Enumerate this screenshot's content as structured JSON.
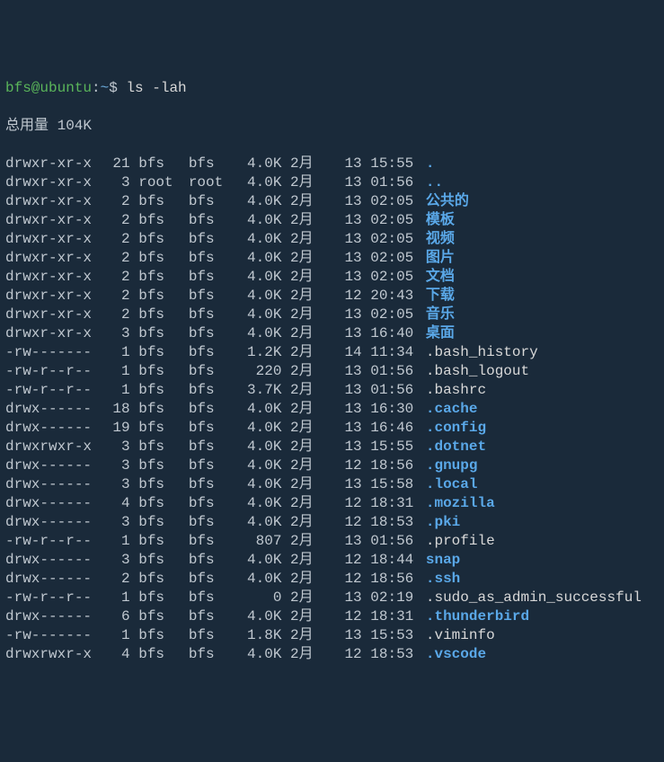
{
  "prompt": {
    "user_host": "bfs@ubuntu",
    "colon": ":",
    "path": "~",
    "symbol": "$ ",
    "command": "ls -lah"
  },
  "total_line": "总用量 104K",
  "rows": [
    {
      "perms": "drwxr-xr-x",
      "links": "21",
      "owner": "bfs",
      "group": "bfs",
      "size": "4.0K",
      "month": "2月",
      "day": "13",
      "time": "15:55",
      "name": ".",
      "kind": "dir"
    },
    {
      "perms": "drwxr-xr-x",
      "links": "3",
      "owner": "root",
      "group": "root",
      "size": "4.0K",
      "month": "2月",
      "day": "13",
      "time": "01:56",
      "name": "..",
      "kind": "dir"
    },
    {
      "perms": "drwxr-xr-x",
      "links": "2",
      "owner": "bfs",
      "group": "bfs",
      "size": "4.0K",
      "month": "2月",
      "day": "13",
      "time": "02:05",
      "name": "公共的",
      "kind": "dir"
    },
    {
      "perms": "drwxr-xr-x",
      "links": "2",
      "owner": "bfs",
      "group": "bfs",
      "size": "4.0K",
      "month": "2月",
      "day": "13",
      "time": "02:05",
      "name": "模板",
      "kind": "dir"
    },
    {
      "perms": "drwxr-xr-x",
      "links": "2",
      "owner": "bfs",
      "group": "bfs",
      "size": "4.0K",
      "month": "2月",
      "day": "13",
      "time": "02:05",
      "name": "视频",
      "kind": "dir"
    },
    {
      "perms": "drwxr-xr-x",
      "links": "2",
      "owner": "bfs",
      "group": "bfs",
      "size": "4.0K",
      "month": "2月",
      "day": "13",
      "time": "02:05",
      "name": "图片",
      "kind": "dir"
    },
    {
      "perms": "drwxr-xr-x",
      "links": "2",
      "owner": "bfs",
      "group": "bfs",
      "size": "4.0K",
      "month": "2月",
      "day": "13",
      "time": "02:05",
      "name": "文档",
      "kind": "dir"
    },
    {
      "perms": "drwxr-xr-x",
      "links": "2",
      "owner": "bfs",
      "group": "bfs",
      "size": "4.0K",
      "month": "2月",
      "day": "12",
      "time": "20:43",
      "name": "下载",
      "kind": "dir"
    },
    {
      "perms": "drwxr-xr-x",
      "links": "2",
      "owner": "bfs",
      "group": "bfs",
      "size": "4.0K",
      "month": "2月",
      "day": "13",
      "time": "02:05",
      "name": "音乐",
      "kind": "dir"
    },
    {
      "perms": "drwxr-xr-x",
      "links": "3",
      "owner": "bfs",
      "group": "bfs",
      "size": "4.0K",
      "month": "2月",
      "day": "13",
      "time": "16:40",
      "name": "桌面",
      "kind": "dir"
    },
    {
      "perms": "-rw-------",
      "links": "1",
      "owner": "bfs",
      "group": "bfs",
      "size": "1.2K",
      "month": "2月",
      "day": "14",
      "time": "11:34",
      "name": ".bash_history",
      "kind": "file"
    },
    {
      "perms": "-rw-r--r--",
      "links": "1",
      "owner": "bfs",
      "group": "bfs",
      "size": "220",
      "month": "2月",
      "day": "13",
      "time": "01:56",
      "name": ".bash_logout",
      "kind": "file"
    },
    {
      "perms": "-rw-r--r--",
      "links": "1",
      "owner": "bfs",
      "group": "bfs",
      "size": "3.7K",
      "month": "2月",
      "day": "13",
      "time": "01:56",
      "name": ".bashrc",
      "kind": "file"
    },
    {
      "perms": "drwx------",
      "links": "18",
      "owner": "bfs",
      "group": "bfs",
      "size": "4.0K",
      "month": "2月",
      "day": "13",
      "time": "16:30",
      "name": ".cache",
      "kind": "dir"
    },
    {
      "perms": "drwx------",
      "links": "19",
      "owner": "bfs",
      "group": "bfs",
      "size": "4.0K",
      "month": "2月",
      "day": "13",
      "time": "16:46",
      "name": ".config",
      "kind": "dir"
    },
    {
      "perms": "drwxrwxr-x",
      "links": "3",
      "owner": "bfs",
      "group": "bfs",
      "size": "4.0K",
      "month": "2月",
      "day": "13",
      "time": "15:55",
      "name": ".dotnet",
      "kind": "dir"
    },
    {
      "perms": "drwx------",
      "links": "3",
      "owner": "bfs",
      "group": "bfs",
      "size": "4.0K",
      "month": "2月",
      "day": "12",
      "time": "18:56",
      "name": ".gnupg",
      "kind": "dir"
    },
    {
      "perms": "drwx------",
      "links": "3",
      "owner": "bfs",
      "group": "bfs",
      "size": "4.0K",
      "month": "2月",
      "day": "13",
      "time": "15:58",
      "name": ".local",
      "kind": "dir"
    },
    {
      "perms": "drwx------",
      "links": "4",
      "owner": "bfs",
      "group": "bfs",
      "size": "4.0K",
      "month": "2月",
      "day": "12",
      "time": "18:31",
      "name": ".mozilla",
      "kind": "dir"
    },
    {
      "perms": "drwx------",
      "links": "3",
      "owner": "bfs",
      "group": "bfs",
      "size": "4.0K",
      "month": "2月",
      "day": "12",
      "time": "18:53",
      "name": ".pki",
      "kind": "dir"
    },
    {
      "perms": "-rw-r--r--",
      "links": "1",
      "owner": "bfs",
      "group": "bfs",
      "size": "807",
      "month": "2月",
      "day": "13",
      "time": "01:56",
      "name": ".profile",
      "kind": "file"
    },
    {
      "perms": "drwx------",
      "links": "3",
      "owner": "bfs",
      "group": "bfs",
      "size": "4.0K",
      "month": "2月",
      "day": "12",
      "time": "18:44",
      "name": "snap",
      "kind": "dir"
    },
    {
      "perms": "drwx------",
      "links": "2",
      "owner": "bfs",
      "group": "bfs",
      "size": "4.0K",
      "month": "2月",
      "day": "12",
      "time": "18:56",
      "name": ".ssh",
      "kind": "dir"
    },
    {
      "perms": "-rw-r--r--",
      "links": "1",
      "owner": "bfs",
      "group": "bfs",
      "size": "0",
      "month": "2月",
      "day": "13",
      "time": "02:19",
      "name": ".sudo_as_admin_successful",
      "kind": "file"
    },
    {
      "perms": "drwx------",
      "links": "6",
      "owner": "bfs",
      "group": "bfs",
      "size": "4.0K",
      "month": "2月",
      "day": "12",
      "time": "18:31",
      "name": ".thunderbird",
      "kind": "dir"
    },
    {
      "perms": "-rw-------",
      "links": "1",
      "owner": "bfs",
      "group": "bfs",
      "size": "1.8K",
      "month": "2月",
      "day": "13",
      "time": "15:53",
      "name": ".viminfo",
      "kind": "file"
    },
    {
      "perms": "drwxrwxr-x",
      "links": "4",
      "owner": "bfs",
      "group": "bfs",
      "size": "4.0K",
      "month": "2月",
      "day": "12",
      "time": "18:53",
      "name": ".vscode",
      "kind": "dir"
    }
  ]
}
